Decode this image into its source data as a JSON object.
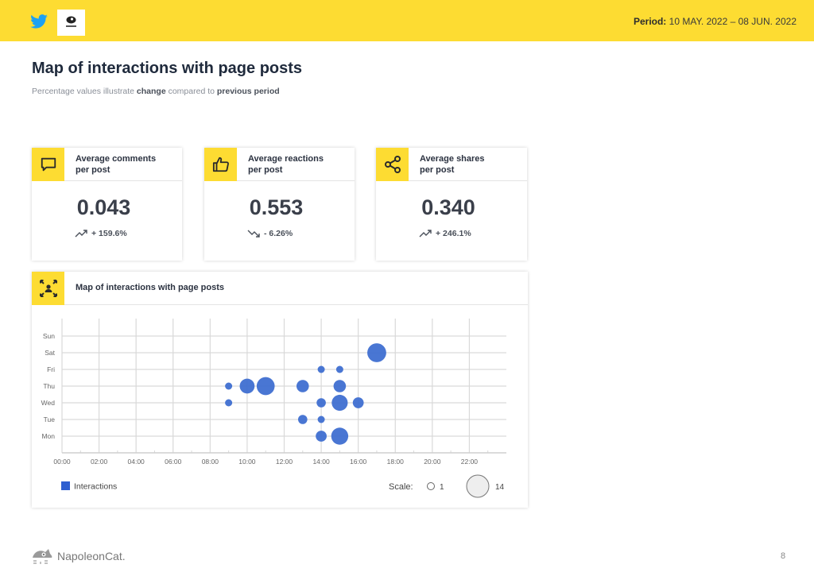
{
  "header": {
    "period_label": "Period:",
    "period_value": "10 MAY. 2022 – 08 JUN. 2022",
    "icons": [
      "twitter-icon",
      "profile-logo"
    ]
  },
  "page": {
    "title": "Map of interactions with page posts",
    "subtitle_parts": [
      "Percentage values illustrate ",
      "change",
      " compared to ",
      "previous period"
    ],
    "page_number": "8",
    "footer_brand": "NapoleonCat."
  },
  "metrics": [
    {
      "icon": "comment-icon",
      "title_line1": "Average comments",
      "title_line2": "per post",
      "value": "0.043",
      "trend": "up",
      "change": "+ 159.6%"
    },
    {
      "icon": "thumbs-up-icon",
      "title_line1": "Average reactions",
      "title_line2": "per post",
      "value": "0.553",
      "trend": "down",
      "change": "- 6.26%"
    },
    {
      "icon": "share-icon",
      "title_line1": "Average shares",
      "title_line2": "per post",
      "value": "0.340",
      "trend": "up",
      "change": "+ 246.1%"
    }
  ],
  "chart_card": {
    "title": "Map of interactions with page posts",
    "icon": "people-expand-icon"
  },
  "colors": {
    "accent": "#fddc32",
    "bubble": "#3f6fd1",
    "grid": "#d9d9d9"
  },
  "chart_data": {
    "type": "scatter",
    "subtype": "bubble",
    "title": "Map of interactions with page posts",
    "xlabel": "",
    "ylabel": "",
    "x_ticks": [
      "00:00",
      "02:00",
      "04:00",
      "06:00",
      "08:00",
      "10:00",
      "12:00",
      "14:00",
      "16:00",
      "18:00",
      "20:00",
      "22:00"
    ],
    "y_categories": [
      "Mon",
      "Tue",
      "Wed",
      "Thu",
      "Fri",
      "Sat",
      "Sun"
    ],
    "xlim": [
      0,
      24
    ],
    "grid": true,
    "legend": {
      "series_name": "Interactions",
      "placement": "bottom-left"
    },
    "scale": {
      "label": "Scale:",
      "min": 1,
      "max": 14
    },
    "series": [
      {
        "name": "Interactions",
        "points": [
          {
            "hour": 9,
            "day": "Thu",
            "value": 1
          },
          {
            "hour": 9,
            "day": "Wed",
            "value": 1
          },
          {
            "hour": 10,
            "day": "Thu",
            "value": 6
          },
          {
            "hour": 11,
            "day": "Thu",
            "value": 9
          },
          {
            "hour": 13,
            "day": "Thu",
            "value": 4
          },
          {
            "hour": 13,
            "day": "Tue",
            "value": 2
          },
          {
            "hour": 14,
            "day": "Fri",
            "value": 1
          },
          {
            "hour": 14,
            "day": "Wed",
            "value": 2
          },
          {
            "hour": 14,
            "day": "Tue",
            "value": 1
          },
          {
            "hour": 14,
            "day": "Mon",
            "value": 3
          },
          {
            "hour": 15,
            "day": "Fri",
            "value": 1
          },
          {
            "hour": 15,
            "day": "Thu",
            "value": 4
          },
          {
            "hour": 15,
            "day": "Wed",
            "value": 7
          },
          {
            "hour": 15,
            "day": "Mon",
            "value": 8
          },
          {
            "hour": 16,
            "day": "Wed",
            "value": 3
          },
          {
            "hour": 17,
            "day": "Sat",
            "value": 10
          }
        ]
      }
    ]
  }
}
